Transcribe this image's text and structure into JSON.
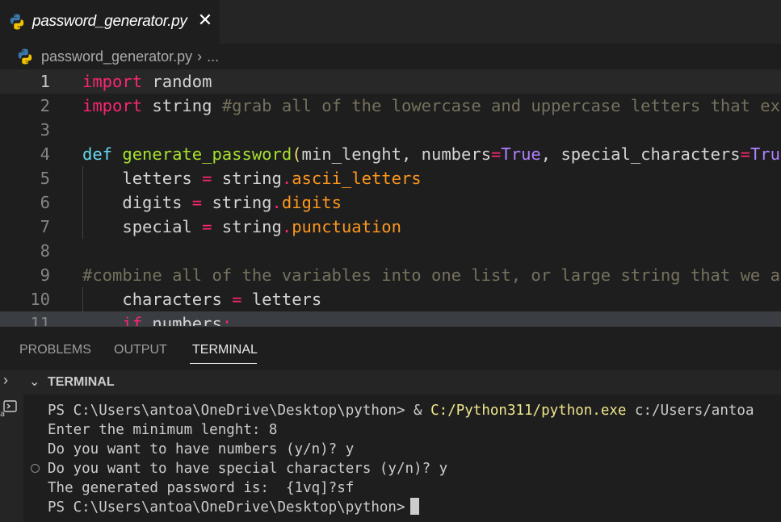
{
  "tab": {
    "title": "password_generator.py",
    "close": "✕"
  },
  "breadcrumb": {
    "file": "password_generator.py",
    "separator": "›",
    "more": "..."
  },
  "editor": {
    "lines": [
      {
        "n": "1",
        "tokens": [
          [
            "kw",
            "import"
          ],
          [
            "p",
            " random"
          ]
        ]
      },
      {
        "n": "2",
        "tokens": [
          [
            "kw",
            "import"
          ],
          [
            "p",
            " string "
          ],
          [
            "cmt",
            "#grab all of the lowercase and uppercase letters that ex"
          ]
        ]
      },
      {
        "n": "3",
        "tokens": []
      },
      {
        "n": "4",
        "tokens": [
          [
            "def",
            "def"
          ],
          [
            "p",
            " "
          ],
          [
            "fn",
            "generate_password"
          ],
          [
            "paren",
            "("
          ],
          [
            "p",
            "min_lenght, numbers"
          ],
          [
            "op",
            "="
          ],
          [
            "cls",
            "True"
          ],
          [
            "p",
            ", special_characters"
          ],
          [
            "op",
            "="
          ],
          [
            "cls",
            "Tru"
          ]
        ]
      },
      {
        "n": "5",
        "tokens": [
          [
            "p",
            "    letters "
          ],
          [
            "op",
            "="
          ],
          [
            "p",
            " string"
          ],
          [
            "op",
            "."
          ],
          [
            "attr",
            "ascii_letters"
          ]
        ]
      },
      {
        "n": "6",
        "tokens": [
          [
            "p",
            "    digits "
          ],
          [
            "op",
            "="
          ],
          [
            "p",
            " string"
          ],
          [
            "op",
            "."
          ],
          [
            "attr",
            "digits"
          ]
        ]
      },
      {
        "n": "7",
        "tokens": [
          [
            "p",
            "    special "
          ],
          [
            "op",
            "="
          ],
          [
            "p",
            " string"
          ],
          [
            "op",
            "."
          ],
          [
            "attr",
            "punctuation"
          ]
        ]
      },
      {
        "n": "8",
        "tokens": []
      },
      {
        "n": "9",
        "tokens": [
          [
            "cmt",
            "#combine all of the variables into one list, or large string that we a"
          ]
        ]
      },
      {
        "n": "10",
        "tokens": [
          [
            "p",
            "    characters "
          ],
          [
            "op",
            "="
          ],
          [
            "p",
            " letters"
          ]
        ]
      },
      {
        "n": "11",
        "tokens": [
          [
            "p",
            "    "
          ],
          [
            "kw",
            "if"
          ],
          [
            "p",
            " numbers"
          ],
          [
            "op",
            ":"
          ]
        ]
      }
    ]
  },
  "panel": {
    "tabs": [
      "PROBLEMS",
      "OUTPUT",
      "TERMINAL"
    ],
    "active_tab": "TERMINAL",
    "section_title": "TERMINAL"
  },
  "terminal": {
    "lines": [
      {
        "parts": [
          [
            "n",
            "PS C:\\Users\\antoa\\OneDrive\\Desktop\\python> & "
          ],
          [
            "y",
            "C:/Python311/python.exe"
          ],
          [
            "n",
            " c:/Users/antoa"
          ]
        ]
      },
      {
        "parts": [
          [
            "n",
            "Enter the minimum lenght: 8"
          ]
        ]
      },
      {
        "parts": [
          [
            "n",
            "Do you want to have numbers (y/n)? y"
          ]
        ]
      },
      {
        "parts": [
          [
            "n",
            "Do you want to have special characters (y/n)? y"
          ]
        ]
      },
      {
        "parts": [
          [
            "n",
            "The generated password is:  {1vq]?sf"
          ]
        ]
      },
      {
        "parts": [
          [
            "n",
            "PS C:\\Users\\antoa\\OneDrive\\Desktop\\python>"
          ]
        ],
        "cursor": true
      }
    ]
  },
  "colors": {
    "keyword": "#f92672",
    "def": "#66d9ef",
    "function": "#a6e22e",
    "comment": "#75715e",
    "constant": "#ae81ff",
    "attribute": "#fd971f",
    "terminal_exe": "#f0e68c",
    "background": "#1e1e1e"
  },
  "icons": {
    "file": "python-icon",
    "close": "close-icon",
    "terminal": "terminal-icon"
  }
}
